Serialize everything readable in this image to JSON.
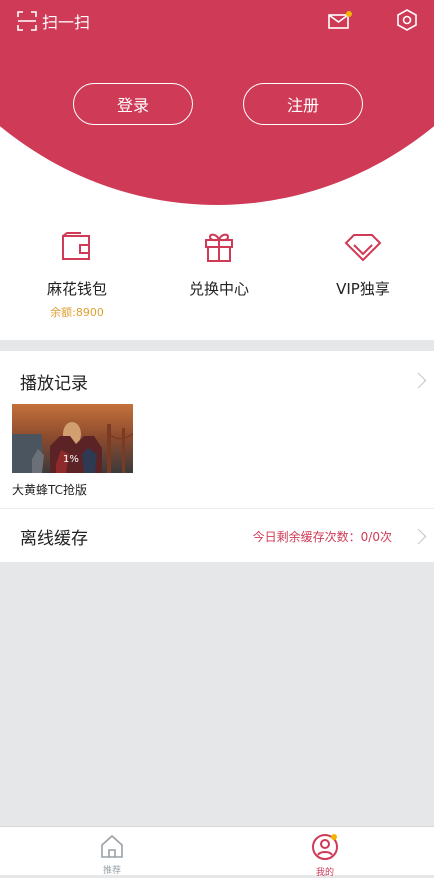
{
  "header": {
    "scan_label": "扫一扫",
    "login_label": "登录",
    "register_label": "注册",
    "accent": "#cf3a56",
    "badge_color": "#f5b400"
  },
  "features": [
    {
      "label": "麻花钱包",
      "sub": "余额:8900",
      "icon": "wallet-icon"
    },
    {
      "label": "兑换中心",
      "icon": "gift-icon"
    },
    {
      "label": "VIP独享",
      "icon": "diamond-icon"
    }
  ],
  "history": {
    "title": "播放记录",
    "items": [
      {
        "title": "大黄蜂TC抢版",
        "progress": "1%"
      }
    ]
  },
  "offline": {
    "title": "离线缓存",
    "info": "今日剩余缓存次数：0/0次"
  },
  "tabs": [
    {
      "label": "推荐",
      "icon": "home-icon"
    },
    {
      "label": "我的",
      "icon": "profile-icon",
      "active": true
    }
  ]
}
